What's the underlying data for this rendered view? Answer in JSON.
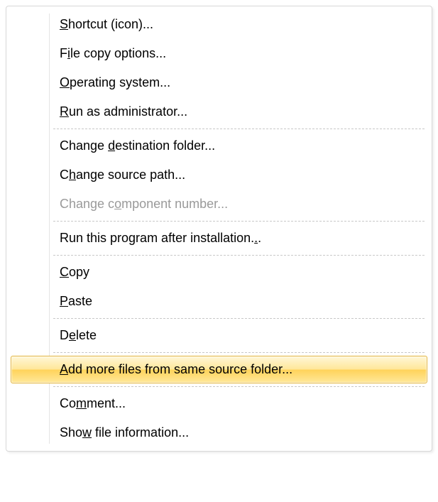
{
  "menu": {
    "items": [
      {
        "kind": "item",
        "mnemonic_index": 0,
        "label": "Shortcut (icon)...",
        "disabled": false,
        "highlighted": false,
        "name": "menu-item-shortcut-icon"
      },
      {
        "kind": "item",
        "mnemonic_index": 1,
        "label": "File copy options...",
        "disabled": false,
        "highlighted": false,
        "name": "menu-item-file-copy-options"
      },
      {
        "kind": "item",
        "mnemonic_index": 0,
        "label": "Operating system...",
        "disabled": false,
        "highlighted": false,
        "name": "menu-item-operating-system"
      },
      {
        "kind": "item",
        "mnemonic_index": 0,
        "label": "Run as administrator...",
        "disabled": false,
        "highlighted": false,
        "name": "menu-item-run-as-administrator"
      },
      {
        "kind": "sep"
      },
      {
        "kind": "item",
        "mnemonic_index": 7,
        "label": "Change destination folder...",
        "disabled": false,
        "highlighted": false,
        "name": "menu-item-change-destination-folder"
      },
      {
        "kind": "item",
        "mnemonic_index": 1,
        "label": "Change source path...",
        "disabled": false,
        "highlighted": false,
        "name": "menu-item-change-source-path"
      },
      {
        "kind": "item",
        "mnemonic_index": 8,
        "label": "Change component number...",
        "disabled": true,
        "highlighted": false,
        "name": "menu-item-change-component-number"
      },
      {
        "kind": "sep"
      },
      {
        "kind": "item",
        "mnemonic_index": 36,
        "label": "Run this program after installation...",
        "disabled": false,
        "highlighted": false,
        "name": "menu-item-run-after-installation"
      },
      {
        "kind": "sep"
      },
      {
        "kind": "item",
        "mnemonic_index": 0,
        "label": "Copy",
        "disabled": false,
        "highlighted": false,
        "name": "menu-item-copy"
      },
      {
        "kind": "item",
        "mnemonic_index": 0,
        "label": "Paste",
        "disabled": false,
        "highlighted": false,
        "name": "menu-item-paste"
      },
      {
        "kind": "sep"
      },
      {
        "kind": "item",
        "mnemonic_index": 1,
        "label": "Delete",
        "disabled": false,
        "highlighted": false,
        "name": "menu-item-delete"
      },
      {
        "kind": "sep"
      },
      {
        "kind": "item",
        "mnemonic_index": 0,
        "label": "Add more files from same source folder...",
        "disabled": false,
        "highlighted": true,
        "name": "menu-item-add-more-files"
      },
      {
        "kind": "sep"
      },
      {
        "kind": "item",
        "mnemonic_index": 2,
        "label": "Comment...",
        "disabled": false,
        "highlighted": false,
        "name": "menu-item-comment"
      },
      {
        "kind": "item",
        "mnemonic_index": 3,
        "label": "Show file information...",
        "disabled": false,
        "highlighted": false,
        "name": "menu-item-show-file-information"
      }
    ]
  }
}
